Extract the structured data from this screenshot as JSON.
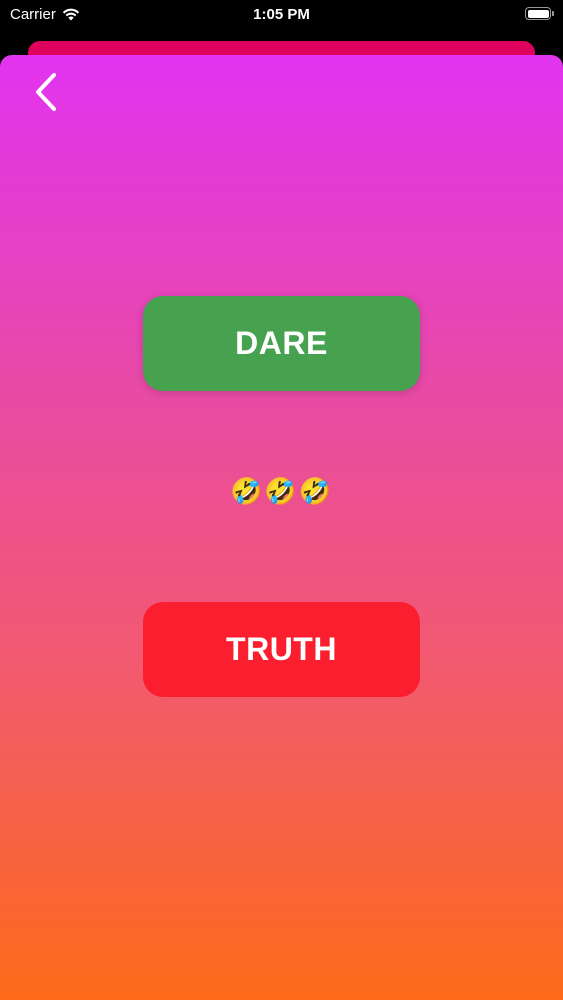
{
  "status_bar": {
    "carrier": "Carrier",
    "time": "1:05 PM",
    "icons": [
      "wifi-icon",
      "battery-icon"
    ]
  },
  "sheet": {
    "gradient_colors": [
      "#e233f0",
      "#e84aa6",
      "#f25a6e",
      "#fd6b1a"
    ],
    "back_icon": "chevron-left-icon",
    "dare_label": "DARE",
    "dare_color": "#46a24e",
    "emoji_text": "🤣🤣🤣",
    "truth_label": "TRUTH",
    "truth_color": "#fa1e2e"
  },
  "back_card_color": "#e0005e"
}
